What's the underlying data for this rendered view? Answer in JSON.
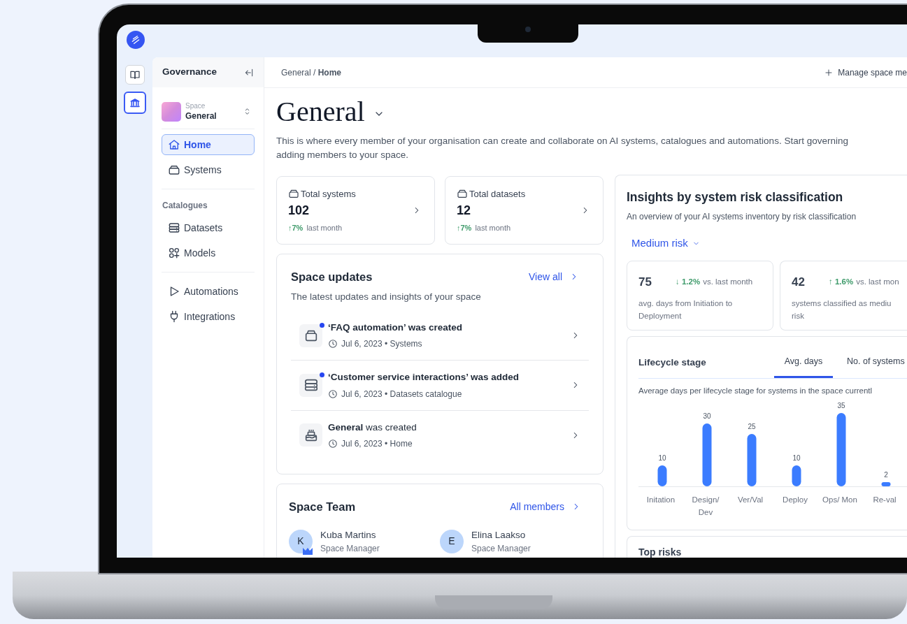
{
  "rail": [
    {
      "kind": "book",
      "selected": false
    },
    {
      "kind": "bank",
      "selected": true
    }
  ],
  "sidebar": {
    "title": "Governance",
    "space": {
      "label": "Space",
      "name": "General"
    },
    "groups": [
      {
        "items": [
          {
            "label": "Home",
            "kind": "home",
            "selected": true
          },
          {
            "label": "Systems",
            "kind": "box",
            "selected": false
          }
        ]
      },
      {
        "title": "Catalogues",
        "items": [
          {
            "label": "Datasets",
            "kind": "database",
            "selected": false
          },
          {
            "label": "Models",
            "kind": "models",
            "selected": false
          }
        ]
      },
      {
        "items": [
          {
            "label": "Automations",
            "kind": "play",
            "selected": false
          },
          {
            "label": "Integrations",
            "kind": "plug",
            "selected": false
          }
        ]
      }
    ]
  },
  "breadcrumb": "General / **Home**",
  "manage_button": "Manage space me",
  "page": {
    "title": "General",
    "description_lines": [
      "This is where every member of your organisation can create and collaborate on AI systems, catalogues and automations. Start governing",
      "adding members to your space."
    ]
  },
  "stats": [
    {
      "label": "Total systems",
      "value": "102",
      "change": "↑7%",
      "period": "last month"
    },
    {
      "label": "Total datasets",
      "value": "12",
      "change": "↑7%",
      "period": "last month"
    }
  ],
  "updates": {
    "title": "Space updates",
    "link": "View all",
    "subtitle": "The latest updates and insights of your space",
    "items": [
      {
        "kind": "automation",
        "title": "‘FAQ automation’ was created",
        "bold": true,
        "unread": true,
        "meta": "Jul 6, 2023 • Systems"
      },
      {
        "kind": "dataset",
        "title": "‘Customer service interactions’ was added",
        "bold": true,
        "unread": true,
        "meta": "Jul 6, 2023 • Datasets catalogue"
      },
      {
        "kind": "space",
        "title": "**General** was created",
        "bold": false,
        "unread": false,
        "meta": "Jul 6, 2023 • Home"
      }
    ]
  },
  "team": {
    "title": "Space Team",
    "link": "All members",
    "members": [
      {
        "initial": "K",
        "name": "Kuba Martins",
        "role": "Space Manager",
        "crown": true
      },
      {
        "initial": "E",
        "name": "Elina Laakso",
        "role": "Space Manager",
        "crown": false
      }
    ]
  },
  "insights": {
    "title": "Insights by system risk classification",
    "subtitle": "An overview of your AI systems inventory by risk classification",
    "filter": "Medium risk",
    "metrics": [
      {
        "value": "75",
        "change": "↓ 1.2%",
        "suffix": "vs. last month",
        "description": "avg. days from Initiation to Deployment"
      },
      {
        "value": "42",
        "change": "↑ 1.6%",
        "suffix": "vs. last mon",
        "description": "systems classified as mediu risk"
      }
    ],
    "lifecycle": {
      "title": "Lifecycle stage",
      "tabs": [
        {
          "label": "Avg. days",
          "selected": true
        },
        {
          "label": "No. of systems",
          "selected": false
        }
      ],
      "subtitle": "Average days per lifecycle stage for systems in the space currentl",
      "chart_data": {
        "type": "bar",
        "categories": [
          "Initation",
          "Design/ Dev",
          "Ver/Val",
          "Deploy",
          "Ops/ Mon",
          "Re-val"
        ],
        "values": [
          10,
          30,
          25,
          10,
          35,
          2
        ],
        "data_labels": true
      }
    },
    "top_risks": {
      "title": "Top risks"
    }
  }
}
